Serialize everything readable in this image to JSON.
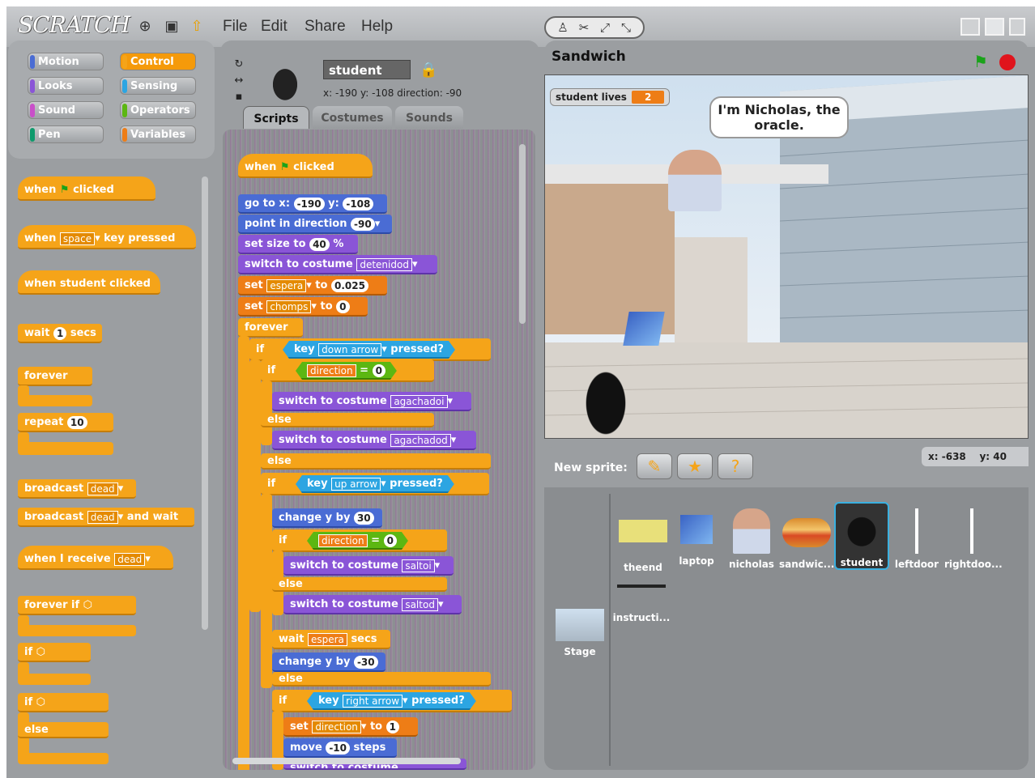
{
  "app": {
    "logo": "SCRATCH"
  },
  "menu": [
    "File",
    "Edit",
    "Share",
    "Help"
  ],
  "categories": [
    "Motion",
    "Control",
    "Looks",
    "Sensing",
    "Sound",
    "Operators",
    "Pen",
    "Variables"
  ],
  "palette": {
    "when_flag": [
      "when",
      "clicked"
    ],
    "when_key": [
      "when",
      "space",
      "key pressed"
    ],
    "when_clicked": "when student clicked",
    "wait": [
      "wait",
      "1",
      "secs"
    ],
    "forever": "forever",
    "repeat": [
      "repeat",
      "10"
    ],
    "broadcast": [
      "broadcast",
      "dead"
    ],
    "broadcast_wait": [
      "broadcast",
      "dead",
      "and wait"
    ],
    "receive": [
      "when I receive",
      "dead"
    ],
    "forever_if": "forever if",
    "if1": "if",
    "if2": "if",
    "else": "else"
  },
  "sprite": {
    "name": "student",
    "coords": "x: -190  y: -108  direction: -90"
  },
  "tabs": [
    "Scripts",
    "Costumes",
    "Sounds"
  ],
  "script": {
    "hat": [
      "when",
      "clicked"
    ],
    "goto": [
      "go to x:",
      "-190",
      "y:",
      "-108"
    ],
    "point": [
      "point in direction",
      "-90"
    ],
    "size": [
      "set size to",
      "40",
      "%"
    ],
    "costume1": [
      "switch to costume",
      "detenidod"
    ],
    "set1": [
      "set",
      "espera",
      "to",
      "0.025"
    ],
    "set2": [
      "set",
      "chomps",
      "to",
      "0"
    ],
    "forever": "forever",
    "if": "if",
    "key1": [
      "key",
      "down arrow",
      "pressed?"
    ],
    "dir1": [
      "direction",
      "=",
      "0"
    ],
    "costume2": [
      "switch to costume",
      "agachadoi"
    ],
    "else": "else",
    "costume3": [
      "switch to costume",
      "agachadod"
    ],
    "key2": [
      "key",
      "up arrow",
      "pressed?"
    ],
    "change1": [
      "change y by",
      "30"
    ],
    "costume4": [
      "switch to costume",
      "saltoi"
    ],
    "costume5": [
      "switch to costume",
      "saltod"
    ],
    "wait": [
      "wait",
      "espera",
      "secs"
    ],
    "change2": [
      "change y by",
      "-30"
    ],
    "key3": [
      "key",
      "right arrow",
      "pressed?"
    ],
    "set3": [
      "set",
      "direction",
      "to",
      "1"
    ],
    "move": [
      "move",
      "-10",
      "steps"
    ],
    "costume6": [
      "switch to costume",
      ""
    ]
  },
  "stage": {
    "title": "Sandwich",
    "monitor_label": "student lives",
    "monitor_value": "2",
    "bubble": "I'm Nicholas, the oracle."
  },
  "mouse": {
    "x_label": "x:",
    "x": "-638",
    "y_label": "y:",
    "y": "40"
  },
  "new_sprite_label": "New sprite:",
  "sprites": [
    "theend",
    "laptop",
    "nicholas",
    "sandwic...",
    "student",
    "leftdoor",
    "rightdoo...",
    "instructi..."
  ],
  "stage_thumb_label": "Stage",
  "colors": {
    "control": "#f5a419",
    "motion": "#4a6cd4",
    "looks": "#8a55d7",
    "variables": "#ee7d16",
    "sensing": "#2ca5e2",
    "operators": "#5cb712"
  }
}
